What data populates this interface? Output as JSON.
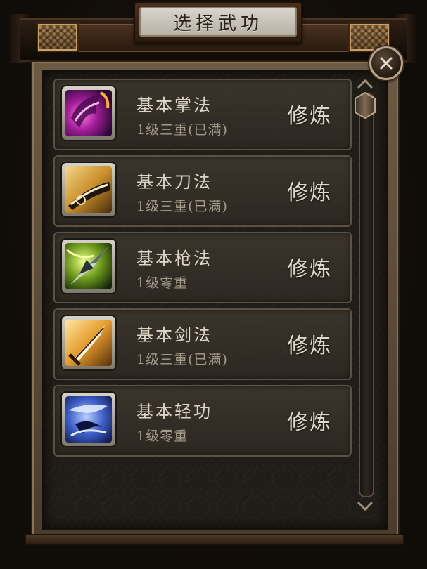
{
  "title": "选择武功",
  "close_icon": "close-x-icon",
  "train_label": "修炼",
  "skills": [
    {
      "name": "基本掌法",
      "level": "1级三重(已满)",
      "icon": "palm-skill-icon"
    },
    {
      "name": "基本刀法",
      "level": "1级三重(已满)",
      "icon": "blade-skill-icon"
    },
    {
      "name": "基本枪法",
      "level": "1级零重",
      "icon": "spear-skill-icon"
    },
    {
      "name": "基本剑法",
      "level": "1级三重(已满)",
      "icon": "sword-skill-icon"
    },
    {
      "name": "基本轻功",
      "level": "1级零重",
      "icon": "lightness-skill-icon"
    }
  ],
  "colors": {
    "panel_bg": "#201c17",
    "row_bg": "#3a342c",
    "frame_wood": "#6d5a43",
    "title_plaque": "#d8d4cc",
    "text_primary": "#ddd6c8",
    "text_secondary": "#a59c8c"
  }
}
